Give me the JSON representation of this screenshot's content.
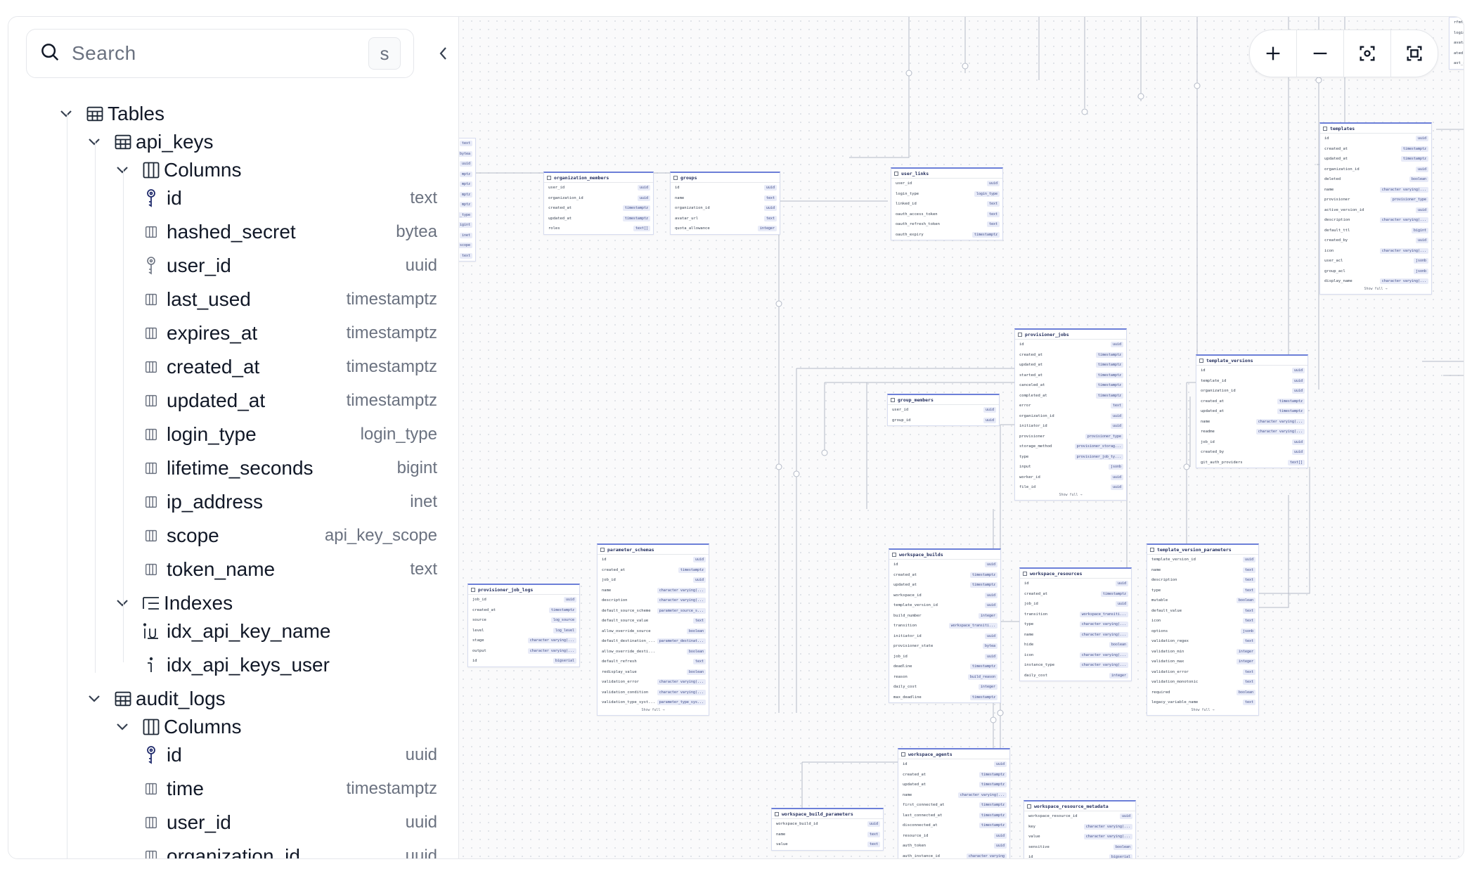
{
  "search": {
    "placeholder": "Search",
    "shortcut": "s"
  },
  "tree": {
    "tables_label": "Tables",
    "api_keys": {
      "name": "api_keys",
      "columns_label": "Columns",
      "columns": [
        {
          "name": "id",
          "type": "text",
          "kind": "key"
        },
        {
          "name": "hashed_secret",
          "type": "bytea",
          "kind": "col"
        },
        {
          "name": "user_id",
          "type": "uuid",
          "kind": "fkey"
        },
        {
          "name": "last_used",
          "type": "timestamptz",
          "kind": "col"
        },
        {
          "name": "expires_at",
          "type": "timestamptz",
          "kind": "col"
        },
        {
          "name": "created_at",
          "type": "timestamptz",
          "kind": "col"
        },
        {
          "name": "updated_at",
          "type": "timestamptz",
          "kind": "col"
        },
        {
          "name": "login_type",
          "type": "login_type",
          "kind": "col"
        },
        {
          "name": "lifetime_seconds",
          "type": "bigint",
          "kind": "col"
        },
        {
          "name": "ip_address",
          "type": "inet",
          "kind": "col"
        },
        {
          "name": "scope",
          "type": "api_key_scope",
          "kind": "col"
        },
        {
          "name": "token_name",
          "type": "text",
          "kind": "col"
        }
      ],
      "indexes_label": "Indexes",
      "indexes": [
        {
          "name": "idx_api_key_name",
          "kind": "unique"
        },
        {
          "name": "idx_api_keys_user",
          "kind": "index"
        }
      ]
    },
    "audit_logs": {
      "name": "audit_logs",
      "columns_label": "Columns",
      "columns": [
        {
          "name": "id",
          "type": "uuid",
          "kind": "key"
        },
        {
          "name": "time",
          "type": "timestamptz",
          "kind": "col"
        },
        {
          "name": "user_id",
          "type": "uuid",
          "kind": "col"
        },
        {
          "name": "organization_id",
          "type": "uuid",
          "kind": "col"
        }
      ]
    }
  },
  "diagram": {
    "show_full": "Show full →",
    "tables": [
      {
        "id": "partial_left",
        "name": "",
        "rows": [
          [
            "",
            "text"
          ],
          [
            "",
            "bytea"
          ],
          [
            "",
            "uuid"
          ],
          [
            "",
            "mptz"
          ],
          [
            "",
            "mptz"
          ],
          [
            "",
            "mptz"
          ],
          [
            "",
            "mptz"
          ],
          [
            "",
            "_type"
          ],
          [
            "",
            "igint"
          ],
          [
            "",
            "inet"
          ],
          [
            "",
            "scope"
          ],
          [
            "",
            "text"
          ]
        ]
      },
      {
        "id": "organization_members",
        "name": "organization_members",
        "rows": [
          [
            "user_id",
            "uuid"
          ],
          [
            "organization_id",
            "uuid"
          ],
          [
            "created_at",
            "timestamptz"
          ],
          [
            "updated_at",
            "timestamptz"
          ],
          [
            "roles",
            "text[]"
          ]
        ]
      },
      {
        "id": "groups",
        "name": "groups",
        "rows": [
          [
            "id",
            "uuid"
          ],
          [
            "name",
            "text"
          ],
          [
            "organization_id",
            "uuid"
          ],
          [
            "avatar_url",
            "text"
          ],
          [
            "quota_allowance",
            "integer"
          ]
        ]
      },
      {
        "id": "user_links",
        "name": "user_links",
        "rows": [
          [
            "user_id",
            "uuid"
          ],
          [
            "login_type",
            "login_type"
          ],
          [
            "linked_id",
            "text"
          ],
          [
            "oauth_access_token",
            "text"
          ],
          [
            "oauth_refresh_token",
            "text"
          ],
          [
            "oauth_expiry",
            "timestamptz"
          ]
        ]
      },
      {
        "id": "templates",
        "name": "templates",
        "show_full": true,
        "rows": [
          [
            "id",
            "uuid"
          ],
          [
            "created_at",
            "timestamptz"
          ],
          [
            "updated_at",
            "timestamptz"
          ],
          [
            "organization_id",
            "uuid"
          ],
          [
            "deleted",
            "boolean"
          ],
          [
            "name",
            "character varying(..."
          ],
          [
            "provisioner",
            "provisioner_type"
          ],
          [
            "active_version_id",
            "uuid"
          ],
          [
            "description",
            "character varying(..."
          ],
          [
            "default_ttl",
            "bigint"
          ],
          [
            "created_by",
            "uuid"
          ],
          [
            "icon",
            "character varying(..."
          ],
          [
            "user_acl",
            "jsonb"
          ],
          [
            "group_acl",
            "jsonb"
          ],
          [
            "display_name",
            "character varying(..."
          ]
        ]
      },
      {
        "id": "provisioner_jobs",
        "name": "provisioner_jobs",
        "show_full": true,
        "rows": [
          [
            "id",
            "uuid"
          ],
          [
            "created_at",
            "timestamptz"
          ],
          [
            "updated_at",
            "timestamptz"
          ],
          [
            "started_at",
            "timestamptz"
          ],
          [
            "canceled_at",
            "timestamptz"
          ],
          [
            "completed_at",
            "timestamptz"
          ],
          [
            "error",
            "text"
          ],
          [
            "organization_id",
            "uuid"
          ],
          [
            "initiator_id",
            "uuid"
          ],
          [
            "provisioner",
            "provisioner_type"
          ],
          [
            "storage_method",
            "provisioner_storag..."
          ],
          [
            "type",
            "provisioner_job_ty..."
          ],
          [
            "input",
            "jsonb"
          ],
          [
            "worker_id",
            "uuid"
          ],
          [
            "file_id",
            "uuid"
          ]
        ]
      },
      {
        "id": "template_versions",
        "name": "template_versions",
        "rows": [
          [
            "id",
            "uuid"
          ],
          [
            "template_id",
            "uuid"
          ],
          [
            "organization_id",
            "uuid"
          ],
          [
            "created_at",
            "timestamptz"
          ],
          [
            "updated_at",
            "timestamptz"
          ],
          [
            "name",
            "character varying(..."
          ],
          [
            "readme",
            "character varying(..."
          ],
          [
            "job_id",
            "uuid"
          ],
          [
            "created_by",
            "uuid"
          ],
          [
            "git_auth_providers",
            "text[]"
          ]
        ]
      },
      {
        "id": "group_members",
        "name": "group_members",
        "rows": [
          [
            "user_id",
            "uuid"
          ],
          [
            "group_id",
            "uuid"
          ]
        ]
      },
      {
        "id": "provisioner_job_logs",
        "name": "provisioner_job_logs",
        "rows": [
          [
            "job_id",
            "uuid"
          ],
          [
            "created_at",
            "timestamptz"
          ],
          [
            "source",
            "log_source"
          ],
          [
            "level",
            "log_level"
          ],
          [
            "stage",
            "character varying(..."
          ],
          [
            "output",
            "character varying(..."
          ],
          [
            "id",
            "bigserial"
          ]
        ]
      },
      {
        "id": "parameter_schemas",
        "name": "parameter_schemas",
        "show_full": true,
        "rows": [
          [
            "id",
            "uuid"
          ],
          [
            "created_at",
            "timestamptz"
          ],
          [
            "job_id",
            "uuid"
          ],
          [
            "name",
            "character varying(..."
          ],
          [
            "description",
            "character varying(..."
          ],
          [
            "default_source_scheme",
            "parameter_source_s..."
          ],
          [
            "default_source_value",
            "text"
          ],
          [
            "allow_override_source",
            "boolean"
          ],
          [
            "default_destination_...",
            "parameter_destinat..."
          ],
          [
            "allow_override_desti...",
            "boolean"
          ],
          [
            "default_refresh",
            "text"
          ],
          [
            "redisplay_value",
            "boolean"
          ],
          [
            "validation_error",
            "character varying(..."
          ],
          [
            "validation_condition",
            "character varying(..."
          ],
          [
            "validation_type_syst...",
            "parameter_type_sys..."
          ]
        ]
      },
      {
        "id": "workspace_builds",
        "name": "workspace_builds",
        "rows": [
          [
            "id",
            "uuid"
          ],
          [
            "created_at",
            "timestamptz"
          ],
          [
            "updated_at",
            "timestamptz"
          ],
          [
            "workspace_id",
            "uuid"
          ],
          [
            "template_version_id",
            "uuid"
          ],
          [
            "build_number",
            "integer"
          ],
          [
            "transition",
            "workspace_transiti..."
          ],
          [
            "initiator_id",
            "uuid"
          ],
          [
            "provisioner_state",
            "bytea"
          ],
          [
            "job_id",
            "uuid"
          ],
          [
            "deadline",
            "timestamptz"
          ],
          [
            "reason",
            "build_reason"
          ],
          [
            "daily_cost",
            "integer"
          ],
          [
            "max_deadline",
            "timestamptz"
          ]
        ]
      },
      {
        "id": "workspace_resources",
        "name": "workspace_resources",
        "rows": [
          [
            "id",
            "uuid"
          ],
          [
            "created_at",
            "timestamptz"
          ],
          [
            "job_id",
            "uuid"
          ],
          [
            "transition",
            "workspace_transiti..."
          ],
          [
            "type",
            "character varying(..."
          ],
          [
            "name",
            "character varying(..."
          ],
          [
            "hide",
            "boolean"
          ],
          [
            "icon",
            "character varying(..."
          ],
          [
            "instance_type",
            "character varying(..."
          ],
          [
            "daily_cost",
            "integer"
          ]
        ]
      },
      {
        "id": "template_version_parameters",
        "name": "template_version_parameters",
        "show_full": true,
        "rows": [
          [
            "template_version_id",
            "uuid"
          ],
          [
            "name",
            "text"
          ],
          [
            "description",
            "text"
          ],
          [
            "type",
            "text"
          ],
          [
            "mutable",
            "boolean"
          ],
          [
            "default_value",
            "text"
          ],
          [
            "icon",
            "text"
          ],
          [
            "options",
            "jsonb"
          ],
          [
            "validation_regex",
            "text"
          ],
          [
            "validation_min",
            "integer"
          ],
          [
            "validation_max",
            "integer"
          ],
          [
            "validation_error",
            "text"
          ],
          [
            "validation_monotonic",
            "text"
          ],
          [
            "required",
            "boolean"
          ],
          [
            "legacy_variable_name",
            "text"
          ]
        ]
      },
      {
        "id": "workspace_agents",
        "name": "workspace_agents",
        "rows": [
          [
            "id",
            "uuid"
          ],
          [
            "created_at",
            "timestamptz"
          ],
          [
            "updated_at",
            "timestamptz"
          ],
          [
            "name",
            "character varying(..."
          ],
          [
            "first_connected_at",
            "timestamptz"
          ],
          [
            "last_connected_at",
            "timestamptz"
          ],
          [
            "disconnected_at",
            "timestamptz"
          ],
          [
            "resource_id",
            "uuid"
          ],
          [
            "auth_token",
            "uuid"
          ],
          [
            "auth_instance_id",
            "character varying"
          ]
        ]
      },
      {
        "id": "workspace_build_parameters",
        "name": "workspace_build_parameters",
        "rows": [
          [
            "workspace_build_id",
            "uuid"
          ],
          [
            "name",
            "text"
          ],
          [
            "value",
            "text"
          ]
        ]
      },
      {
        "id": "workspace_resource_metadata",
        "name": "workspace_resource_metadata",
        "rows": [
          [
            "workspace_resource_id",
            "uuid"
          ],
          [
            "key",
            "character varying(..."
          ],
          [
            "value",
            "character varying(..."
          ],
          [
            "sensitive",
            "boolean"
          ],
          [
            "id",
            "bigserial"
          ]
        ]
      },
      {
        "id": "partial_topright",
        "name": "",
        "rows": [
          [
            "rfmt_ro",
            ""
          ],
          [
            "login_ty",
            ""
          ],
          [
            "avatar_",
            ""
          ],
          [
            "ated",
            ""
          ],
          [
            "ast_see",
            ""
          ]
        ]
      }
    ]
  },
  "zoom_controls": {
    "zoom_in": "zoom-in",
    "zoom_out": "zoom-out",
    "focus": "focus",
    "fit": "fit-view"
  }
}
